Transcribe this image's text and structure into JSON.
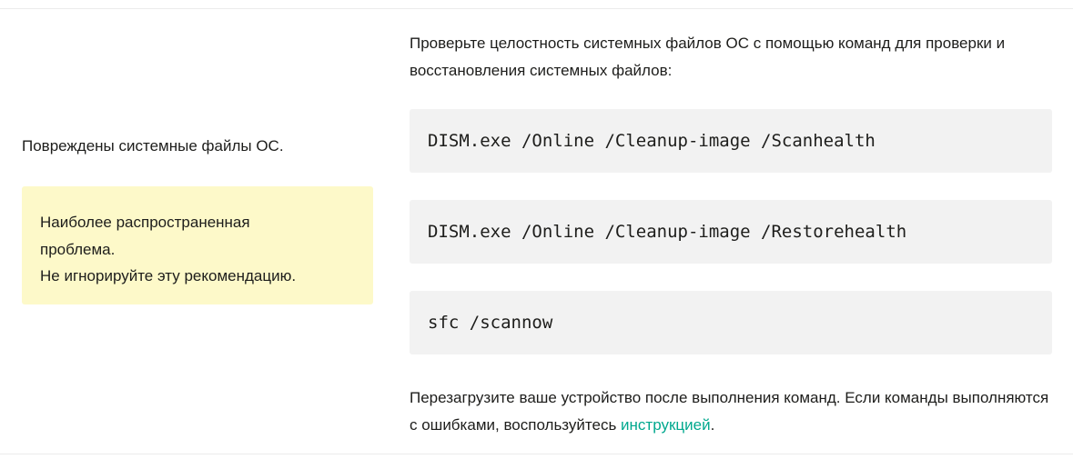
{
  "left": {
    "problem": "Повреждены системные файлы ОС.",
    "note": {
      "line1": "Наиболее распространенная",
      "line2": "проблема.",
      "line3": "Не игнорируйте эту рекомендацию."
    }
  },
  "right": {
    "intro": "Проверьте целостность системных файлов ОС с помощью команд для проверки и восстановления системных файлов:",
    "commands": [
      "DISM.exe /Online /Cleanup-image /Scanhealth",
      "DISM.exe /Online /Cleanup-image /Restorehealth",
      "sfc /scannow"
    ],
    "outro_before_link": "Перезагрузите ваше устройство после выполнения команд. Если команды выполняются с ошибками, воспользуйтесь ",
    "outro_link": "инструкцией",
    "outro_after_link": "."
  },
  "colors": {
    "link": "#00a88e",
    "note_background": "#fdf9c9",
    "code_background": "#f2f2f2"
  }
}
